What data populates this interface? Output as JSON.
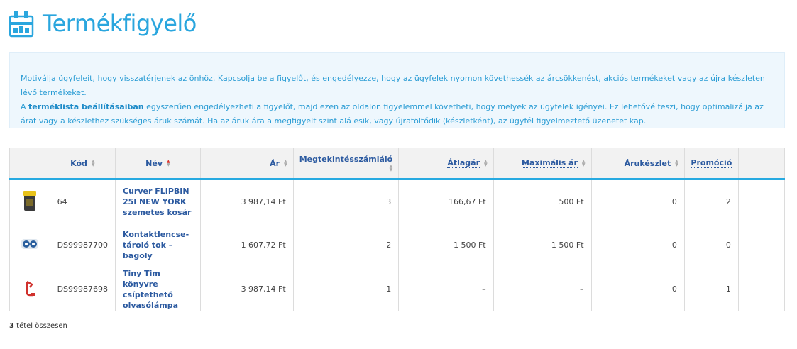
{
  "page": {
    "title": "Termékfigyelő"
  },
  "info": {
    "line1": "Motiválja ügyfeleit, hogy visszatérjenek az önhöz. Kapcsolja be a figyelőt, és engedélyezze, hogy az ügyfelek nyomon követhessék az árcsökkenést, akciós termékeket vagy az újra készleten lévő termékeket.",
    "line2_prefix": "A ",
    "line2_bold": "terméklista beállításaiban",
    "line2_suffix": " egyszerűen engedélyezheti a figyelőt, majd ezen az oldalon figyelemmel követheti, hogy melyek az ügyfelek igényei. Ez lehetővé teszi, hogy optimalizálja az árat vagy a készlethez szükséges áruk számát. Ha az áruk ára a megfigyelt szint alá esik, vagy újratöltődik (készletként), az ügyfél figyelmeztető üzenetet kap."
  },
  "table": {
    "headers": {
      "code": "Kód",
      "name": "Név",
      "price": "Ár",
      "views": "Megtekintésszámláló",
      "avg_price": "Átlagár",
      "max_price": "Maximális ár",
      "stock": "Árukészlet",
      "promo": "Promóció"
    },
    "rows": [
      {
        "image_icon": "trash-bin-icon",
        "code": "64",
        "name": "Curver FLIPBIN 25l NEW YORK szemetes kosár",
        "price": "3 987,14 Ft",
        "views": "3",
        "avg_price": "166,67 Ft",
        "max_price": "500 Ft",
        "stock": "0",
        "promo": "2"
      },
      {
        "image_icon": "owl-lens-case-icon",
        "code": "DS99987700",
        "name": "Kontaktlencse-tároló tok – bagoly",
        "price": "1 607,72 Ft",
        "views": "2",
        "avg_price": "1 500 Ft",
        "max_price": "1 500 Ft",
        "stock": "0",
        "promo": "0"
      },
      {
        "image_icon": "clip-lamp-icon",
        "code": "DS99987698",
        "name": "Tiny Tim könyvre csíptethető olvasólámpa",
        "price": "3 987,14 Ft",
        "views": "1",
        "avg_price": "–",
        "max_price": "–",
        "stock": "0",
        "promo": "1"
      }
    ]
  },
  "footer": {
    "count": "3",
    "label": " tétel összesen"
  },
  "colors": {
    "accent": "#2aa6de",
    "link": "#2c5aa0",
    "info_bg": "#eef7fd",
    "sort_active": "#d9312a"
  }
}
